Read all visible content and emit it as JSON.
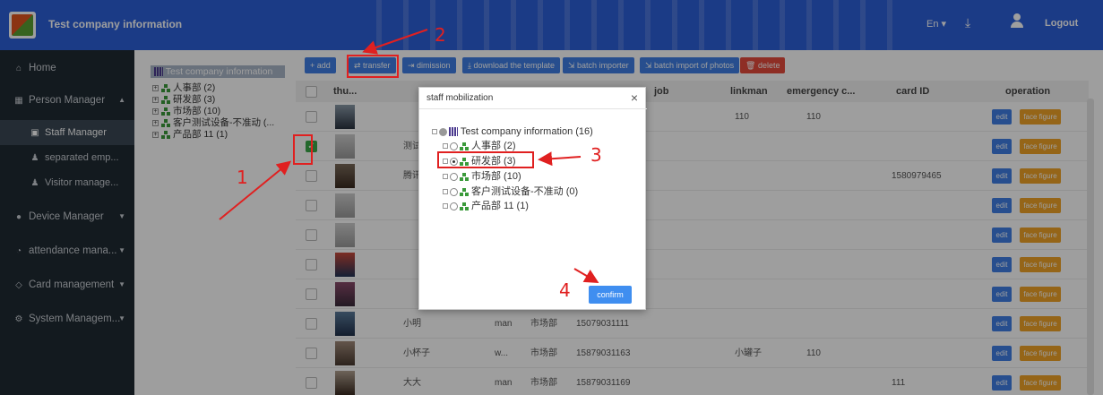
{
  "header": {
    "title": "Test company information",
    "language": "En",
    "logout": "Logout"
  },
  "sidebar": {
    "home": "Home",
    "person_manager": "Person Manager",
    "staff_manager": "Staff Manager",
    "separated": "separated emp...",
    "visitor": "Visitor manage...",
    "device": "Device Manager",
    "attendance": "attendance mana...",
    "card": "Card management",
    "system": "System Managem..."
  },
  "dept_tree": {
    "root": "Test company information",
    "items": [
      "人事部 (2)",
      "研发部 (3)",
      "市场部 (10)",
      "客户测试设备-不准动 (...",
      "产品部 11 (1)"
    ]
  },
  "toolbar": {
    "add": "+ add",
    "transfer": "transfer",
    "dimission": "dimission",
    "download": "download the template",
    "batch_importer": "batch importer",
    "batch_photos": "batch import of photos",
    "delete": "delete"
  },
  "table": {
    "headers": {
      "thumb": "thu...",
      "job": "job",
      "linkman": "linkman",
      "emergency": "emergency c...",
      "card_id": "card ID",
      "operation": "operation"
    },
    "rows": [
      {
        "name": "",
        "gender": "",
        "dept": "",
        "phone": "",
        "linkman": "110",
        "emergency": "110",
        "card": ""
      },
      {
        "name": "测试",
        "gender": "",
        "dept": "",
        "phone": "",
        "linkman": "",
        "emergency": "",
        "card": ""
      },
      {
        "name": "腾讯",
        "gender": "",
        "dept": "",
        "phone": "",
        "linkman": "",
        "emergency": "",
        "card": "1580979465"
      },
      {
        "name": "",
        "gender": "",
        "dept": "",
        "phone": "",
        "linkman": "",
        "emergency": "",
        "card": ""
      },
      {
        "name": "",
        "gender": "",
        "dept": "",
        "phone": "",
        "linkman": "",
        "emergency": "",
        "card": ""
      },
      {
        "name": "",
        "gender": "",
        "dept": "",
        "phone": "",
        "linkman": "",
        "emergency": "",
        "card": ""
      },
      {
        "name": "",
        "gender": "",
        "dept": "",
        "phone": "",
        "linkman": "",
        "emergency": "",
        "card": ""
      },
      {
        "name": "小明",
        "gender": "man",
        "dept": "市场部",
        "phone": "15079031111",
        "linkman": "",
        "emergency": "",
        "card": ""
      },
      {
        "name": "小杯子",
        "gender": "w...",
        "dept": "市场部",
        "phone": "15879031163",
        "linkman": "小罐子",
        "emergency": "110",
        "card": ""
      },
      {
        "name": "大大",
        "gender": "man",
        "dept": "市场部",
        "phone": "15879031169",
        "linkman": "",
        "emergency": "",
        "card": "111"
      }
    ],
    "edit_label": "edit",
    "face_label": "face figure"
  },
  "modal": {
    "title": "staff mobilization",
    "close": "×",
    "root": "Test company information (16)",
    "items": [
      "人事部 (2)",
      "研发部 (3)",
      "市场部 (10)",
      "客户测试设备-不准动 (0)",
      "产品部 11 (1)"
    ],
    "confirm": "confirm"
  },
  "annotations": [
    "1",
    "2",
    "3",
    "4"
  ],
  "colors": {
    "topbar": "#2c5fd8",
    "sidebar": "#1f2a33",
    "annotation": "#e02020",
    "confirm": "#3f8ef0"
  }
}
